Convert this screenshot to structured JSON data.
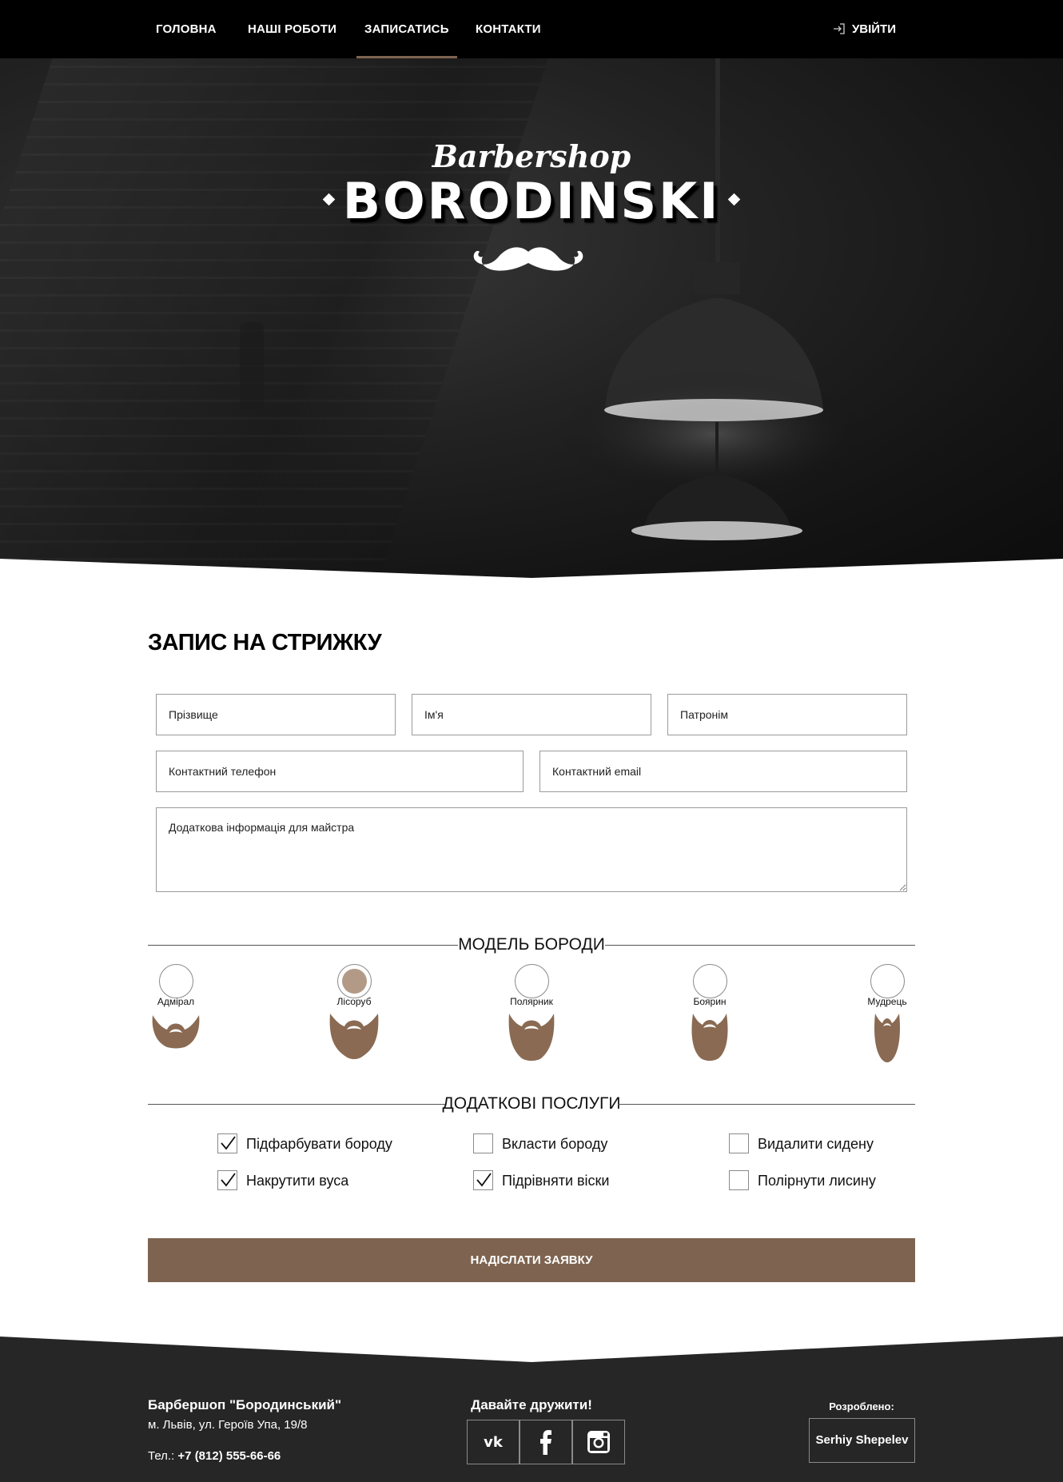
{
  "nav": {
    "items": [
      {
        "label": "ГОЛОВНА",
        "active": false
      },
      {
        "label": "НАШІ РОБОТИ",
        "active": false
      },
      {
        "label": "ЗАПИСАТИСЬ",
        "active": true
      },
      {
        "label": "КОНТАКТИ",
        "active": false
      }
    ],
    "login_label": "УВІЙТИ",
    "login_icon": "login-icon"
  },
  "hero": {
    "brand_script": "Barbershop",
    "brand_main": "BORODINSKI",
    "emblem_icon": "mustache-icon"
  },
  "form": {
    "title": "ЗАПИС НА СТРИЖКУ",
    "placeholders": {
      "surname": "Прізвище",
      "name": "Ім'я",
      "patronymic": "Патронім",
      "phone": "Контактний телефон",
      "email": "Контактний email",
      "notes": "Додаткова інформація для майстра"
    },
    "beard_section_title": "МОДЕЛЬ БОРОДИ",
    "beard_models": [
      {
        "label": "Адмірал",
        "selected": false,
        "icon": "beard-admiral-icon"
      },
      {
        "label": "Лісоруб",
        "selected": true,
        "icon": "beard-lumberjack-icon"
      },
      {
        "label": "Полярник",
        "selected": false,
        "icon": "beard-polar-icon"
      },
      {
        "label": "Боярин",
        "selected": false,
        "icon": "beard-boyar-icon"
      },
      {
        "label": "Мудрець",
        "selected": false,
        "icon": "beard-sage-icon"
      }
    ],
    "services_section_title": "ДОДАТКОВІ ПОСЛУГИ",
    "services": [
      {
        "label": "Підфарбувати бороду",
        "checked": true
      },
      {
        "label": "Вкласти бороду",
        "checked": false
      },
      {
        "label": "Видалити сидену",
        "checked": false
      },
      {
        "label": "Накрутити вуса",
        "checked": true
      },
      {
        "label": "Підрівняти віски",
        "checked": true
      },
      {
        "label": "Полірнути лисину",
        "checked": false
      }
    ],
    "submit_label": "НАДІСЛАТИ ЗАЯВКУ"
  },
  "footer": {
    "brand": "Барбершоп \"Бородинський\"",
    "address": "м. Львів, ул. Героїв Упа, 19/8",
    "phone_prefix": "Тел.: ",
    "phone": "+7 (812) 555-66-66",
    "social_title": "Давайте дружити!",
    "social": [
      "vk-icon",
      "facebook-icon",
      "instagram-icon"
    ],
    "dev_title": "Розроблено:",
    "dev_name": "Serhiy Shepelev"
  },
  "colors": {
    "accent": "#7e6450",
    "beard": "#8a6a52",
    "radio_selected": "#b39a87",
    "nav_bg": "#000000",
    "footer_bg": "#262626"
  }
}
